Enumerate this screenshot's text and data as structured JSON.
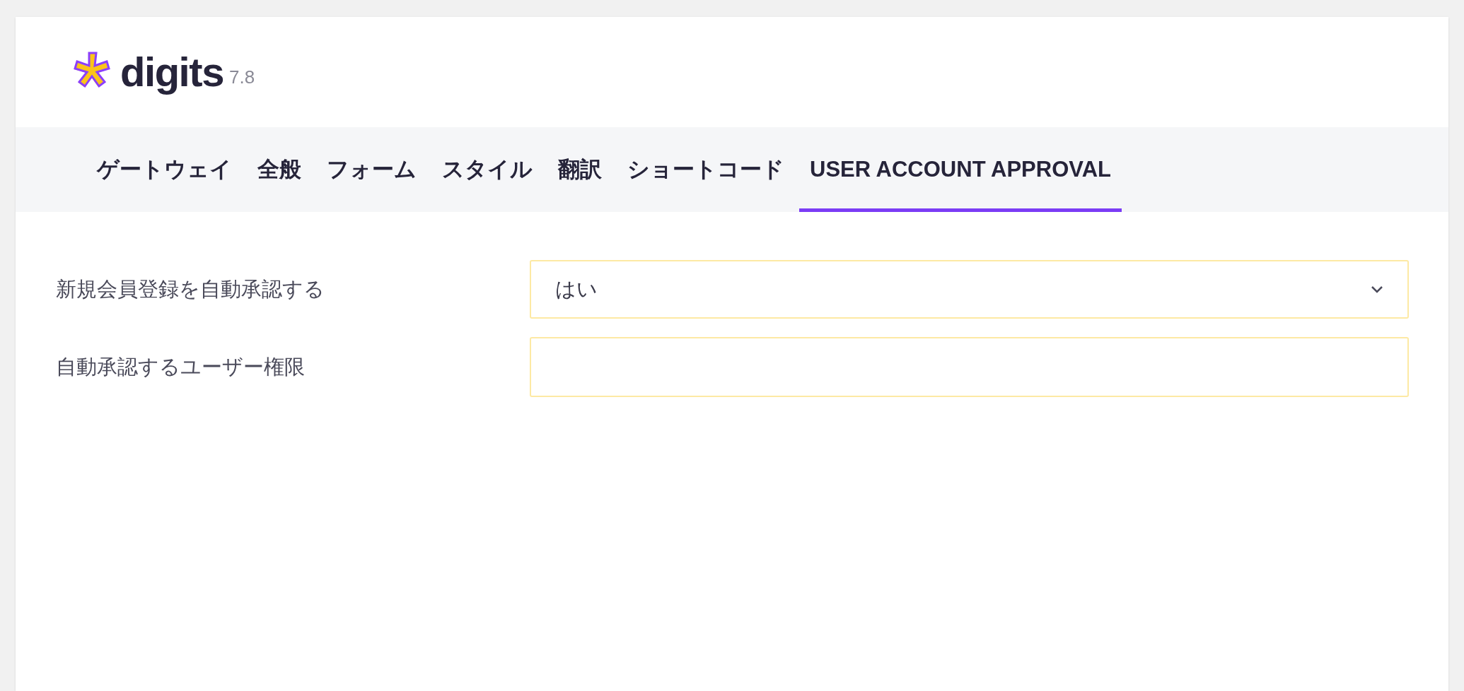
{
  "logo": {
    "name": "digits",
    "version": "7.8"
  },
  "tabs": [
    {
      "label": "ゲートウェイ",
      "selected": false
    },
    {
      "label": "全般",
      "selected": false
    },
    {
      "label": "フォーム",
      "selected": false
    },
    {
      "label": "スタイル",
      "selected": false
    },
    {
      "label": "翻訳",
      "selected": false
    },
    {
      "label": "ショートコード",
      "selected": false
    },
    {
      "label": "USER ACCOUNT APPROVAL",
      "selected": true
    }
  ],
  "fields": [
    {
      "kind": "select",
      "label": "新規会員登録を自動承認する",
      "value": "はい"
    },
    {
      "kind": "text",
      "label": "自動承認するユーザー権限"
    }
  ]
}
